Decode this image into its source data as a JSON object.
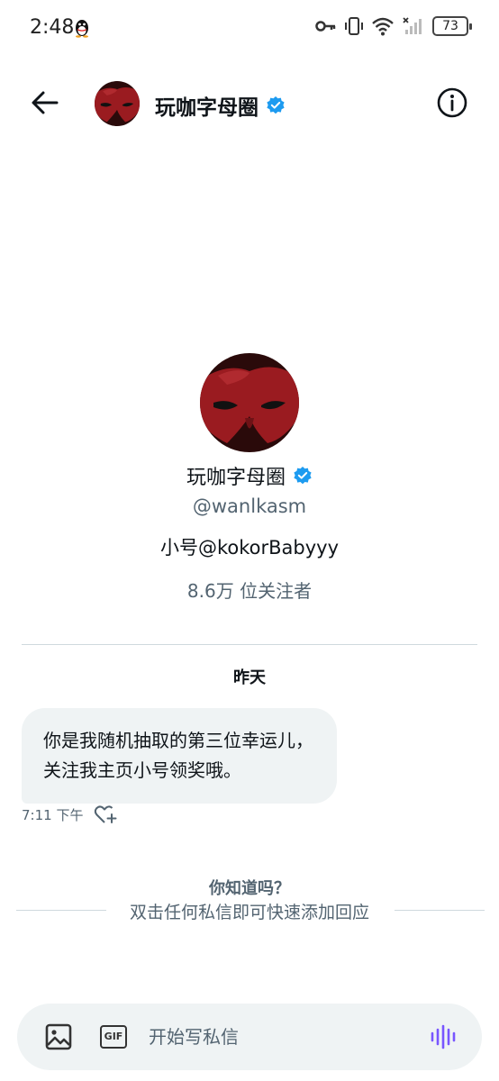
{
  "status_bar": {
    "time": "2:48",
    "battery": "73"
  },
  "header": {
    "title": "玩咖字母圈"
  },
  "profile": {
    "name": "玩咖字母圈",
    "handle": "@wanlkasm",
    "bio": "小号@kokorBabyyy",
    "followers": "8.6万 位关注者"
  },
  "conversation": {
    "date_label": "昨天",
    "messages": [
      {
        "text": "你是我随机抽取的第三位幸运儿，关注我主页小号领奖哦。",
        "time": "7:11 下午"
      }
    ]
  },
  "tip": {
    "title": "你知道吗？",
    "body": "双击任何私信即可快速添加回应"
  },
  "composer": {
    "placeholder": "开始写私信",
    "gif_label": "GIF"
  },
  "colors": {
    "verified": "#1d9bf0",
    "voice": "#7856ff",
    "bubble": "#eff3f4",
    "secondary_text": "#536471"
  }
}
